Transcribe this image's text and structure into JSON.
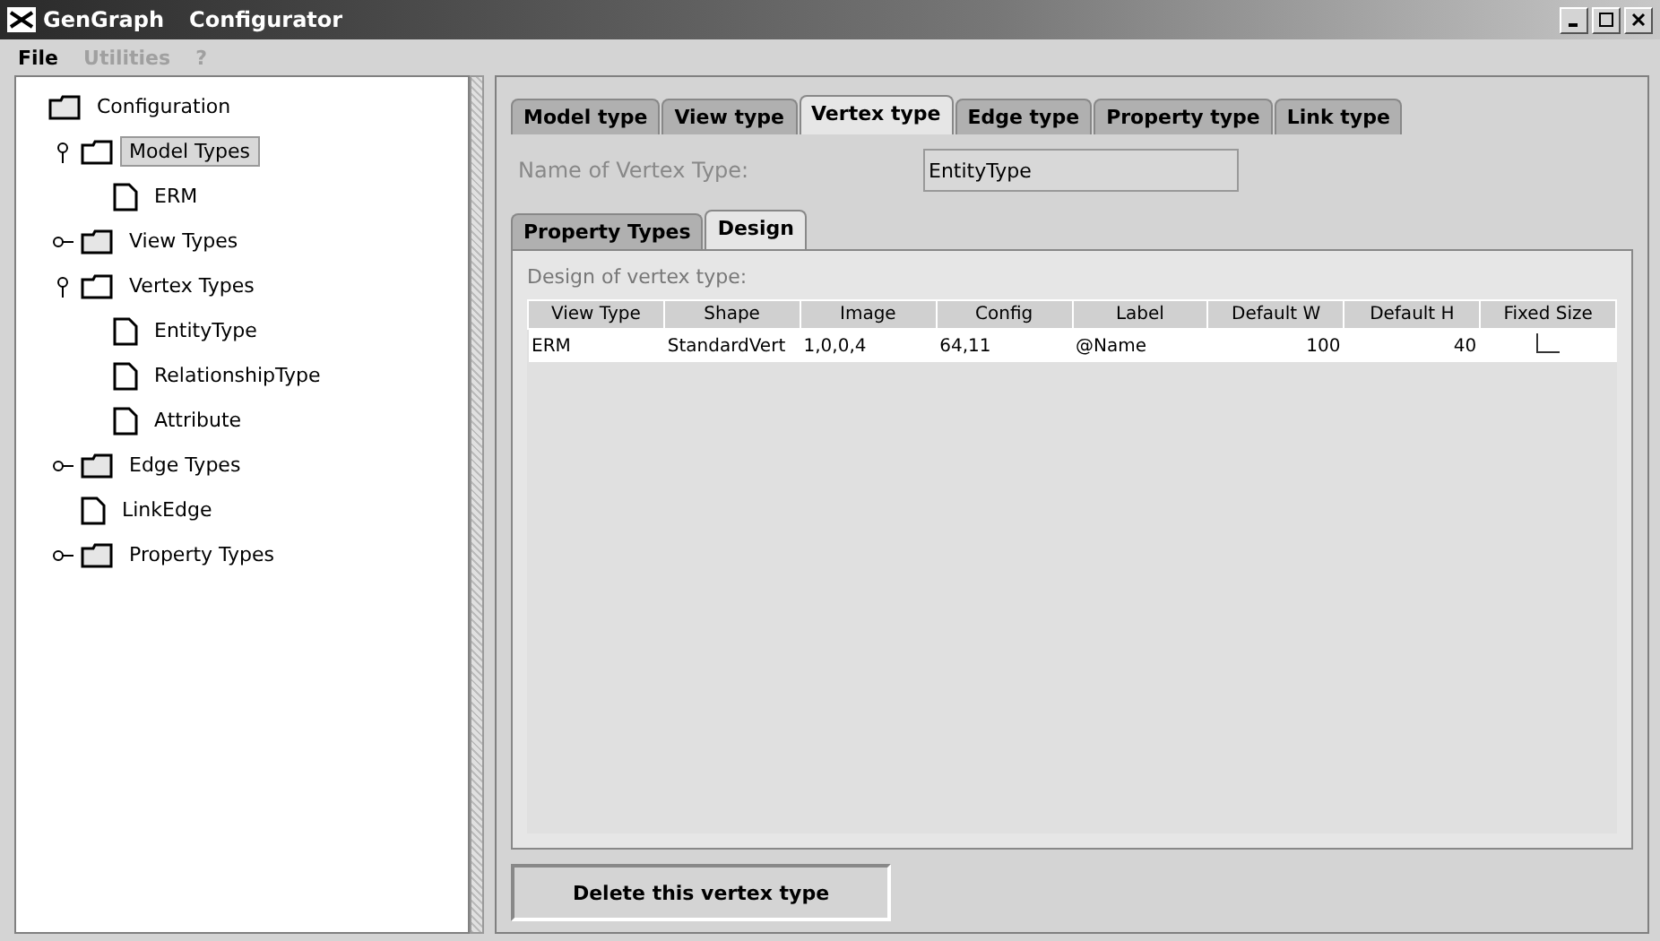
{
  "window": {
    "title_app": "GenGraph",
    "title": "Configurator"
  },
  "menu": [
    {
      "label": "File",
      "disabled": false
    },
    {
      "label": "Utilities",
      "disabled": true
    },
    {
      "label": "?",
      "disabled": true
    }
  ],
  "tree": [
    {
      "label": "Configuration",
      "kind": "root",
      "selected": false,
      "children": [
        {
          "label": "Model Types",
          "kind": "folder",
          "expanded": true,
          "selected": true,
          "children": [
            {
              "label": "ERM",
              "kind": "leaf",
              "selected": false
            }
          ]
        },
        {
          "label": "View Types",
          "kind": "folder",
          "expanded": false,
          "selected": false
        },
        {
          "label": "Vertex Types",
          "kind": "folder",
          "expanded": true,
          "selected": false,
          "children": [
            {
              "label": "EntityType",
              "kind": "leaf",
              "selected": false
            },
            {
              "label": "RelationshipType",
              "kind": "leaf",
              "selected": false
            },
            {
              "label": "Attribute",
              "kind": "leaf",
              "selected": false
            }
          ]
        },
        {
          "label": "Edge Types",
          "kind": "folder",
          "expanded": false,
          "selected": false
        },
        {
          "label": "LinkEdge",
          "kind": "leaf",
          "selected": false
        },
        {
          "label": "Property Types",
          "kind": "folder",
          "expanded": false,
          "selected": false
        }
      ]
    }
  ],
  "tabs": [
    {
      "label": "Model type",
      "selected": false
    },
    {
      "label": "View type",
      "selected": false
    },
    {
      "label": "Vertex type",
      "selected": true
    },
    {
      "label": "Edge type",
      "selected": false
    },
    {
      "label": "Property type",
      "selected": false
    },
    {
      "label": "Link type",
      "selected": false
    }
  ],
  "name_field": {
    "label": "Name of Vertex Type:",
    "value": "EntityType"
  },
  "subtabs": [
    {
      "label": "Property Types",
      "selected": false
    },
    {
      "label": "Design",
      "selected": true
    }
  ],
  "design": {
    "title": "Design of vertex type:",
    "columns": [
      "View Type",
      "Shape",
      "Image",
      "Config",
      "Label",
      "Default W",
      "Default H",
      "Fixed Size"
    ],
    "rows": [
      {
        "cells": [
          "ERM",
          "StandardVert",
          "1,0,0,4",
          "64,11",
          "@Name",
          "100",
          "40"
        ],
        "fixed_size": false
      }
    ]
  },
  "delete_button": "Delete this vertex type"
}
